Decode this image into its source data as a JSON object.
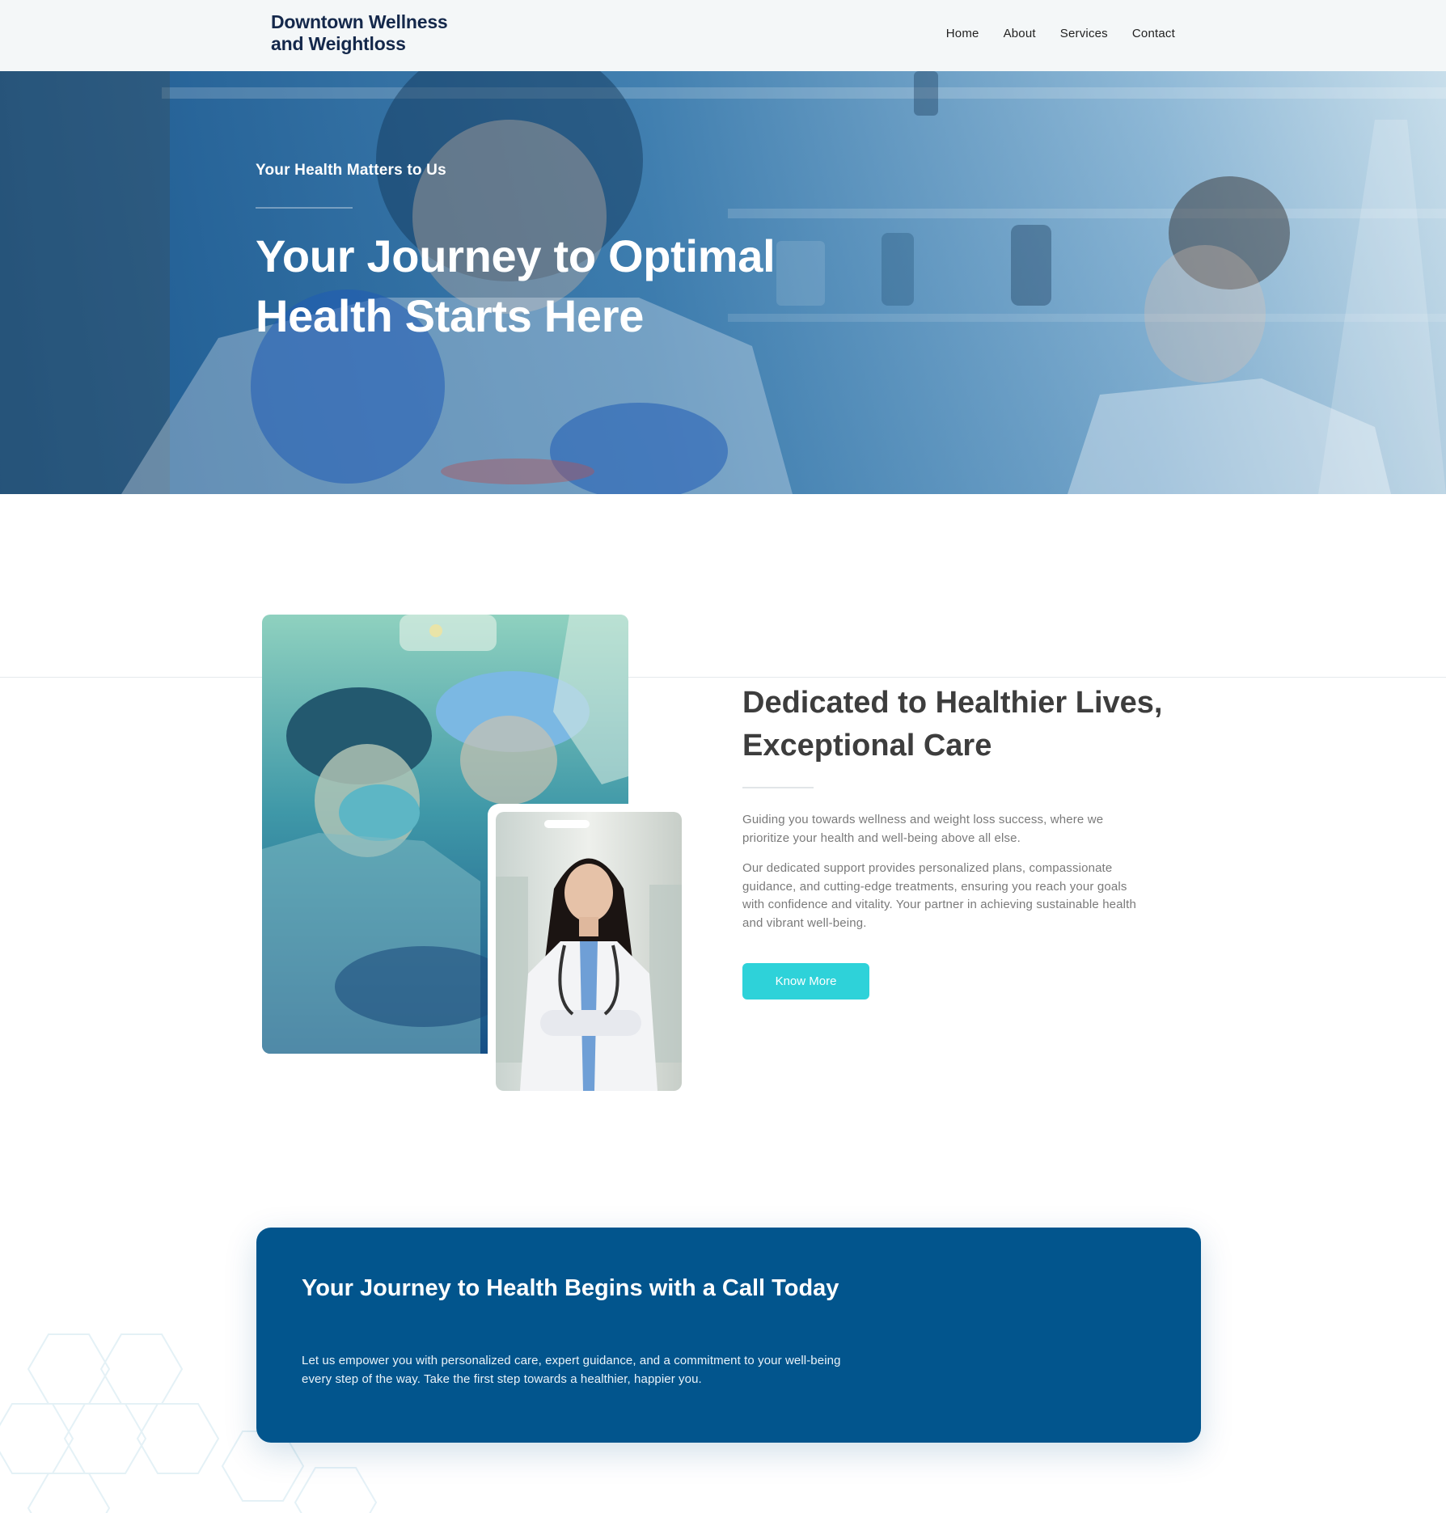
{
  "header": {
    "logo_line1": "Downtown Wellness",
    "logo_line2": "and Weightloss",
    "nav": [
      "Home",
      "About",
      "Services",
      "Contact"
    ]
  },
  "hero": {
    "kicker": "Your Health Matters to Us",
    "title": "Your Journey to Optimal Health Starts Here"
  },
  "about": {
    "title": "Dedicated to Healthier Lives, Exceptional Care",
    "paragraph1": "Guiding you towards wellness and weight loss success, where we prioritize your health and well-being above all else.",
    "paragraph2": "Our dedicated support provides personalized plans, compassionate guidance, and cutting-edge treatments, ensuring you reach your goals with confidence and vitality. Your partner in achieving sustainable health and vibrant well-being.",
    "button_label": "Know More"
  },
  "cta": {
    "title": "Your Journey to Health Begins with a Call Today",
    "text": "Let us empower you with personalized care, expert guidance, and a commitment to your well-being every step of the way. Take the first step towards a healthier, happier you."
  },
  "colors": {
    "brand_navy": "#14284b",
    "accent_cyan": "#2ed2d9",
    "cta_blue": "#02558d"
  }
}
